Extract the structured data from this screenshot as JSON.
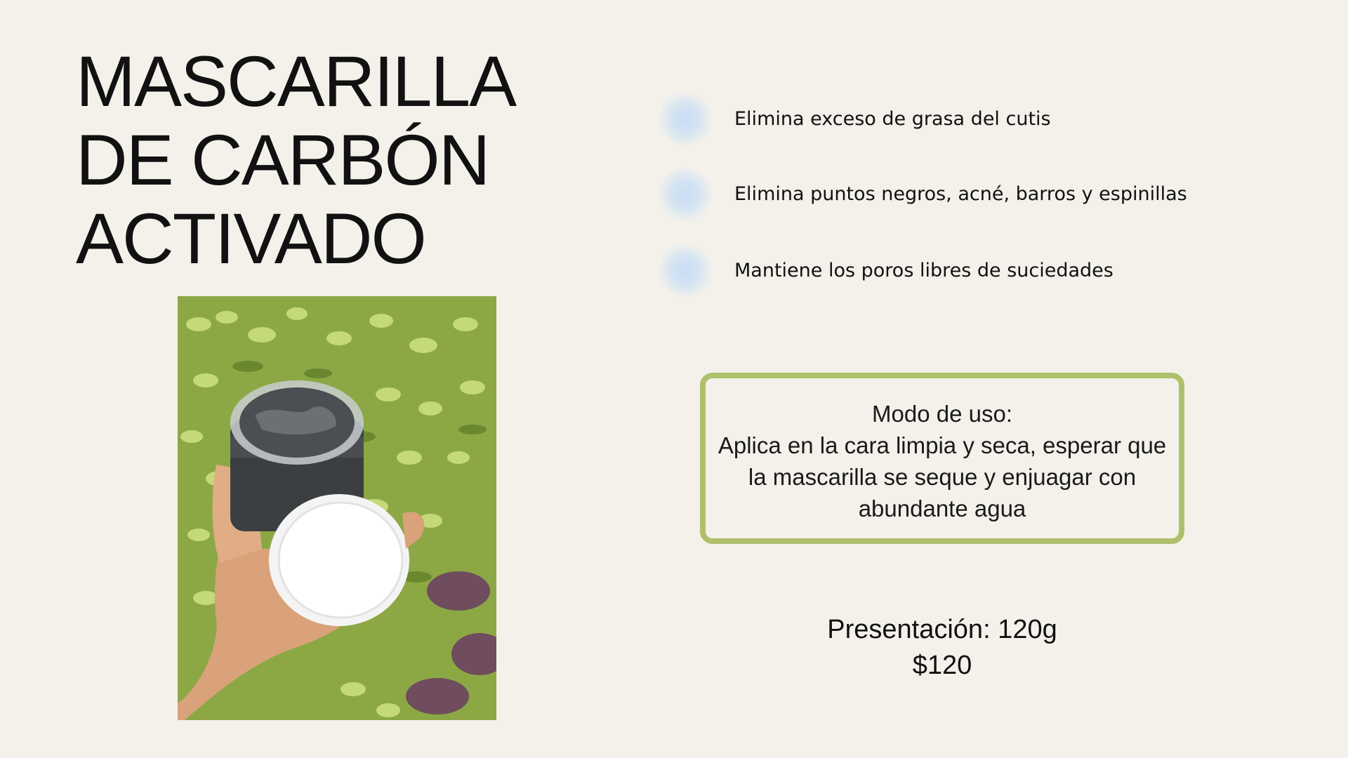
{
  "title": {
    "line1": "MASCARILLA",
    "line2": "DE CARBÓN",
    "line3": "ACTIVADO"
  },
  "benefits": [
    {
      "text": "Elimina exceso de grasa del cutis",
      "icon": "blue-dot-icon"
    },
    {
      "text": "Elimina puntos negros, acné, barros y espinillas",
      "icon": "blue-dot-icon"
    },
    {
      "text": "Mantiene los poros libres de suciedades",
      "icon": "blue-dot-icon"
    }
  ],
  "usage": {
    "heading": "Modo de uso:",
    "line1": "Aplica en la cara limpia y seca, esperar que",
    "line2": "la mascarilla se seque y enjuagar con",
    "line3": "abundante agua"
  },
  "presentation": {
    "size": "Presentación: 120g",
    "price": "$120"
  },
  "colors": {
    "background": "#f3f1ea",
    "box_border": "#afc06c",
    "dot": "#c9def4",
    "text": "#111111"
  }
}
